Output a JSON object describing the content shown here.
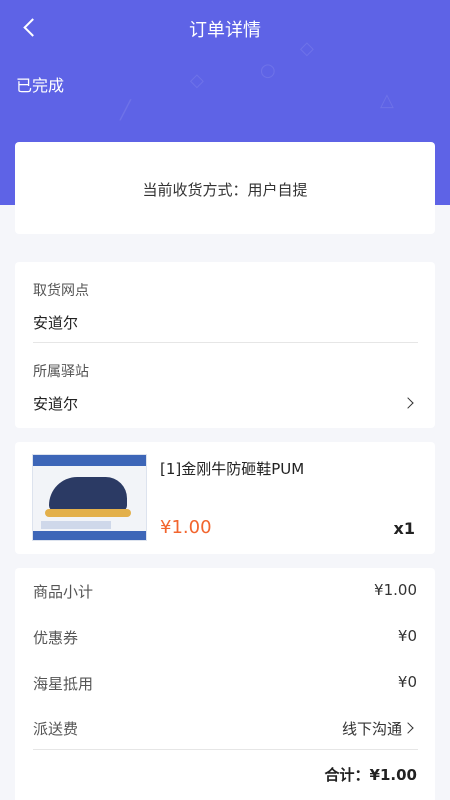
{
  "nav": {
    "title": "订单详情"
  },
  "order": {
    "status": "已完成"
  },
  "delivery": {
    "text": "当前收货方式：用户自提"
  },
  "pickup": {
    "point_label": "取货网点",
    "point_value": "安道尔",
    "station_label": "所属驿站",
    "station_value": "安道尔"
  },
  "product": {
    "name": "[1]金刚牛防砸鞋PUM",
    "price": "¥1.00",
    "quantity": "x1"
  },
  "summary": {
    "rows": [
      {
        "label": "商品小计",
        "value": "¥1.00"
      },
      {
        "label": "优惠券",
        "value": "¥0"
      },
      {
        "label": "海星抵用",
        "value": "¥0"
      },
      {
        "label": "派送费",
        "value": "线下沟通"
      }
    ],
    "total": "合计：¥1.00"
  },
  "colors": {
    "header": "#5e63e6",
    "price": "#f2652e",
    "background": "#f5f6fa"
  }
}
